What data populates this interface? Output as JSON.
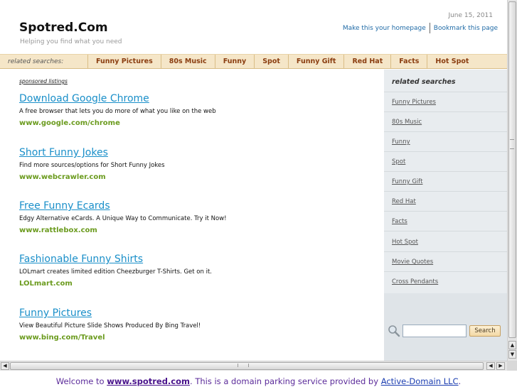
{
  "header": {
    "site_title": "Spotred.Com",
    "tagline": "Helping you find what you need",
    "date": "June 15, 2011",
    "homepage_link": "Make this your homepage",
    "bookmark_link": "Bookmark this page"
  },
  "navbar": {
    "label": "related searches:",
    "items": [
      "Funny Pictures",
      "80s Music",
      "Funny",
      "Spot",
      "Funny Gift",
      "Red Hat",
      "Facts",
      "Hot Spot"
    ]
  },
  "main": {
    "sponsored_label": "sponsored listings",
    "listings": [
      {
        "title": "Download Google Chrome",
        "desc": "A free browser that lets you do more of what you like on the web",
        "url": "www.google.com/chrome"
      },
      {
        "title": "Short Funny Jokes",
        "desc": "Find more sources/options for Short Funny Jokes",
        "url": "www.webcrawler.com"
      },
      {
        "title": "Free Funny Ecards",
        "desc": "Edgy Alternative eCards. A Unique Way to Communicate. Try it Now!",
        "url": "www.rattlebox.com"
      },
      {
        "title": "Fashionable Funny Shirts",
        "desc": "LOLmart creates limited edition Cheezburger T-Shirts. Get on it.",
        "url": "LOLmart.com"
      },
      {
        "title": "Funny Pictures",
        "desc": "View Beautiful Picture Slide Shows Produced By Bing Travel!",
        "url": "www.bing.com/Travel"
      }
    ]
  },
  "sidebar": {
    "heading": "related searches",
    "items": [
      "Funny Pictures",
      "80s Music",
      "Funny",
      "Spot",
      "Funny Gift",
      "Red Hat",
      "Facts",
      "Hot Spot",
      "Movie Quotes",
      "Cross Pendants"
    ],
    "search_value": "",
    "search_button": "Search"
  },
  "footer": {
    "prefix": "Welcome to ",
    "domain": "www.spotred.com",
    "middle": ". This is a domain parking service provided by ",
    "provider": "Active-Domain LLC",
    "suffix": "."
  },
  "icons": {
    "search": "magnifier-icon",
    "scroll_up": "arrow-up-icon",
    "scroll_down": "arrow-down-icon",
    "scroll_left": "arrow-left-icon",
    "scroll_right": "arrow-right-icon"
  },
  "colors": {
    "link_blue": "#1a8fc9",
    "url_green": "#6b9b1e",
    "nav_brown": "#8a3d10",
    "nav_bg": "#f5e6c8",
    "sidebar_bg": "#e8ecef",
    "footer_purple": "#5b2b9a"
  }
}
